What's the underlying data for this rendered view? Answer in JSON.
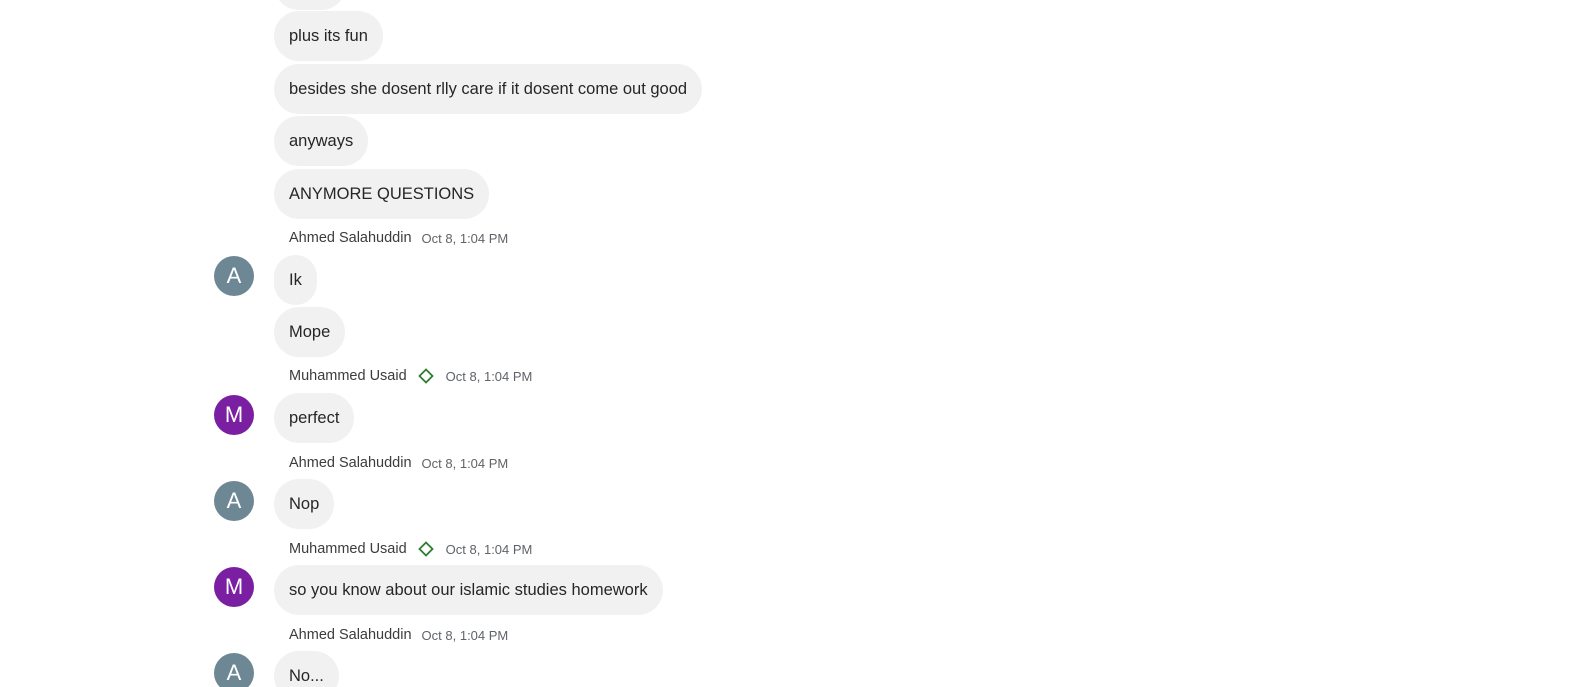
{
  "colors": {
    "bubble_bg": "#f1f1f1",
    "avatar_a": "#6e8795",
    "avatar_m": "#7b1fa2",
    "badge_green": "#2e7d32"
  },
  "messages_top": [
    {
      "text": "plus its fun"
    },
    {
      "text": "besides she dosent rlly care if it dosent come out good"
    },
    {
      "text": "anyways"
    },
    {
      "text": "ANYMORE QUESTIONS"
    }
  ],
  "groups": [
    {
      "sender": "Ahmed Salahuddin",
      "avatar_initial": "A",
      "time": "Oct 8, 1:04 PM",
      "messages": [
        "Ik",
        "Mope"
      ]
    },
    {
      "sender": "Muhammed Usaid",
      "avatar_initial": "M",
      "badge_icon": "diamond-outline-icon",
      "time": "Oct 8, 1:04 PM",
      "messages": [
        "perfect"
      ]
    },
    {
      "sender": "Ahmed Salahuddin",
      "avatar_initial": "A",
      "time": "Oct 8, 1:04 PM",
      "messages": [
        "Nop"
      ]
    },
    {
      "sender": "Muhammed Usaid",
      "avatar_initial": "M",
      "badge_icon": "diamond-outline-icon",
      "time": "Oct 8, 1:04 PM",
      "messages": [
        "so you know about our islamic studies homework"
      ]
    },
    {
      "sender": "Ahmed Salahuddin",
      "avatar_initial": "A",
      "time": "Oct 8, 1:04 PM",
      "messages": [
        "No..."
      ]
    }
  ]
}
